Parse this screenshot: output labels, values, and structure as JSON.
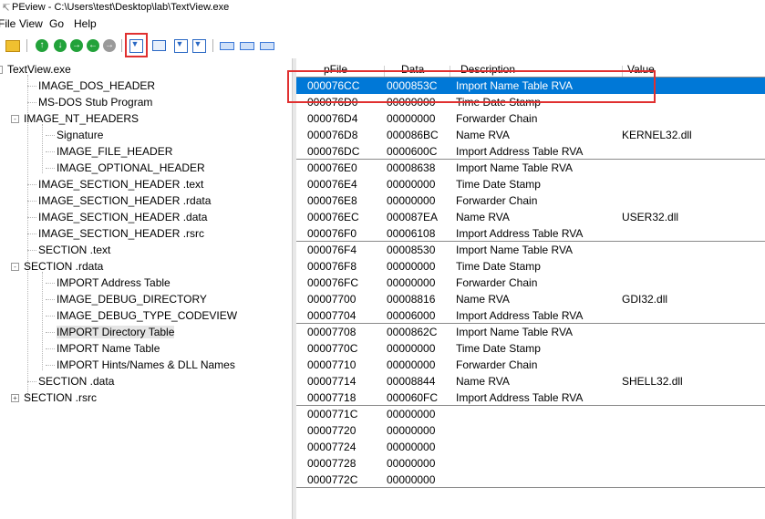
{
  "window": {
    "title": "PEview - C:\\Users\\test\\Desktop\\lab\\TextView.exe"
  },
  "menu": [
    "File",
    "View",
    "Go",
    "Help"
  ],
  "toolbar": {
    "icons": [
      "open-folder-icon",
      "back-icon",
      "forward-icon",
      "up-icon",
      "back-alt-icon",
      "nav-icon",
      "download-icon",
      "envelope-icon",
      "download-up-icon",
      "download-down-icon",
      "view-byte-icon",
      "view-word-icon",
      "view-dword-icon"
    ]
  },
  "tree": [
    {
      "label": "TextView.exe",
      "expander": "-"
    },
    {
      "label": "IMAGE_DOS_HEADER"
    },
    {
      "label": "MS-DOS Stub Program"
    },
    {
      "label": "IMAGE_NT_HEADERS",
      "expander": "-"
    },
    {
      "label": "Signature"
    },
    {
      "label": "IMAGE_FILE_HEADER"
    },
    {
      "label": "IMAGE_OPTIONAL_HEADER"
    },
    {
      "label": "IMAGE_SECTION_HEADER .text"
    },
    {
      "label": "IMAGE_SECTION_HEADER .rdata"
    },
    {
      "label": "IMAGE_SECTION_HEADER .data"
    },
    {
      "label": "IMAGE_SECTION_HEADER .rsrc"
    },
    {
      "label": "SECTION .text"
    },
    {
      "label": "SECTION .rdata",
      "expander": "-"
    },
    {
      "label": "IMPORT Address Table"
    },
    {
      "label": "IMAGE_DEBUG_DIRECTORY"
    },
    {
      "label": "IMAGE_DEBUG_TYPE_CODEVIEW"
    },
    {
      "label": "IMPORT Directory Table",
      "selected": true
    },
    {
      "label": "IMPORT Name Table"
    },
    {
      "label": "IMPORT Hints/Names & DLL Names"
    },
    {
      "label": "SECTION .data"
    },
    {
      "label": "SECTION .rsrc",
      "expander": "+"
    }
  ],
  "table": {
    "columns": [
      "pFile",
      "Data",
      "Description",
      "Value"
    ],
    "rows": [
      {
        "pFile": "000076CC",
        "data": "0000853C",
        "desc": "Import Name Table RVA",
        "value": "",
        "selected": true
      },
      {
        "pFile": "000076D0",
        "data": "00000000",
        "desc": "Time Date Stamp",
        "value": ""
      },
      {
        "pFile": "000076D4",
        "data": "00000000",
        "desc": "Forwarder Chain",
        "value": ""
      },
      {
        "pFile": "000076D8",
        "data": "000086BC",
        "desc": "Name RVA",
        "value": "KERNEL32.dll"
      },
      {
        "pFile": "000076DC",
        "data": "0000600C",
        "desc": "Import Address Table RVA",
        "value": ""
      },
      {
        "pFile": "000076E0",
        "data": "00008638",
        "desc": "Import Name Table RVA",
        "value": ""
      },
      {
        "pFile": "000076E4",
        "data": "00000000",
        "desc": "Time Date Stamp",
        "value": ""
      },
      {
        "pFile": "000076E8",
        "data": "00000000",
        "desc": "Forwarder Chain",
        "value": ""
      },
      {
        "pFile": "000076EC",
        "data": "000087EA",
        "desc": "Name RVA",
        "value": "USER32.dll"
      },
      {
        "pFile": "000076F0",
        "data": "00006108",
        "desc": "Import Address Table RVA",
        "value": ""
      },
      {
        "pFile": "000076F4",
        "data": "00008530",
        "desc": "Import Name Table RVA",
        "value": ""
      },
      {
        "pFile": "000076F8",
        "data": "00000000",
        "desc": "Time Date Stamp",
        "value": ""
      },
      {
        "pFile": "000076FC",
        "data": "00000000",
        "desc": "Forwarder Chain",
        "value": ""
      },
      {
        "pFile": "00007700",
        "data": "00008816",
        "desc": "Name RVA",
        "value": "GDI32.dll"
      },
      {
        "pFile": "00007704",
        "data": "00006000",
        "desc": "Import Address Table RVA",
        "value": ""
      },
      {
        "pFile": "00007708",
        "data": "0000862C",
        "desc": "Import Name Table RVA",
        "value": ""
      },
      {
        "pFile": "0000770C",
        "data": "00000000",
        "desc": "Time Date Stamp",
        "value": ""
      },
      {
        "pFile": "00007710",
        "data": "00000000",
        "desc": "Forwarder Chain",
        "value": ""
      },
      {
        "pFile": "00007714",
        "data": "00008844",
        "desc": "Name RVA",
        "value": "SHELL32.dll"
      },
      {
        "pFile": "00007718",
        "data": "000060FC",
        "desc": "Import Address Table RVA",
        "value": ""
      },
      {
        "pFile": "0000771C",
        "data": "00000000",
        "desc": "",
        "value": ""
      },
      {
        "pFile": "00007720",
        "data": "00000000",
        "desc": "",
        "value": ""
      },
      {
        "pFile": "00007724",
        "data": "00000000",
        "desc": "",
        "value": ""
      },
      {
        "pFile": "00007728",
        "data": "00000000",
        "desc": "",
        "value": ""
      },
      {
        "pFile": "0000772C",
        "data": "00000000",
        "desc": "",
        "value": ""
      }
    ]
  },
  "colors": {
    "selection": "#0078d7",
    "highlight_box": "#e03030"
  }
}
